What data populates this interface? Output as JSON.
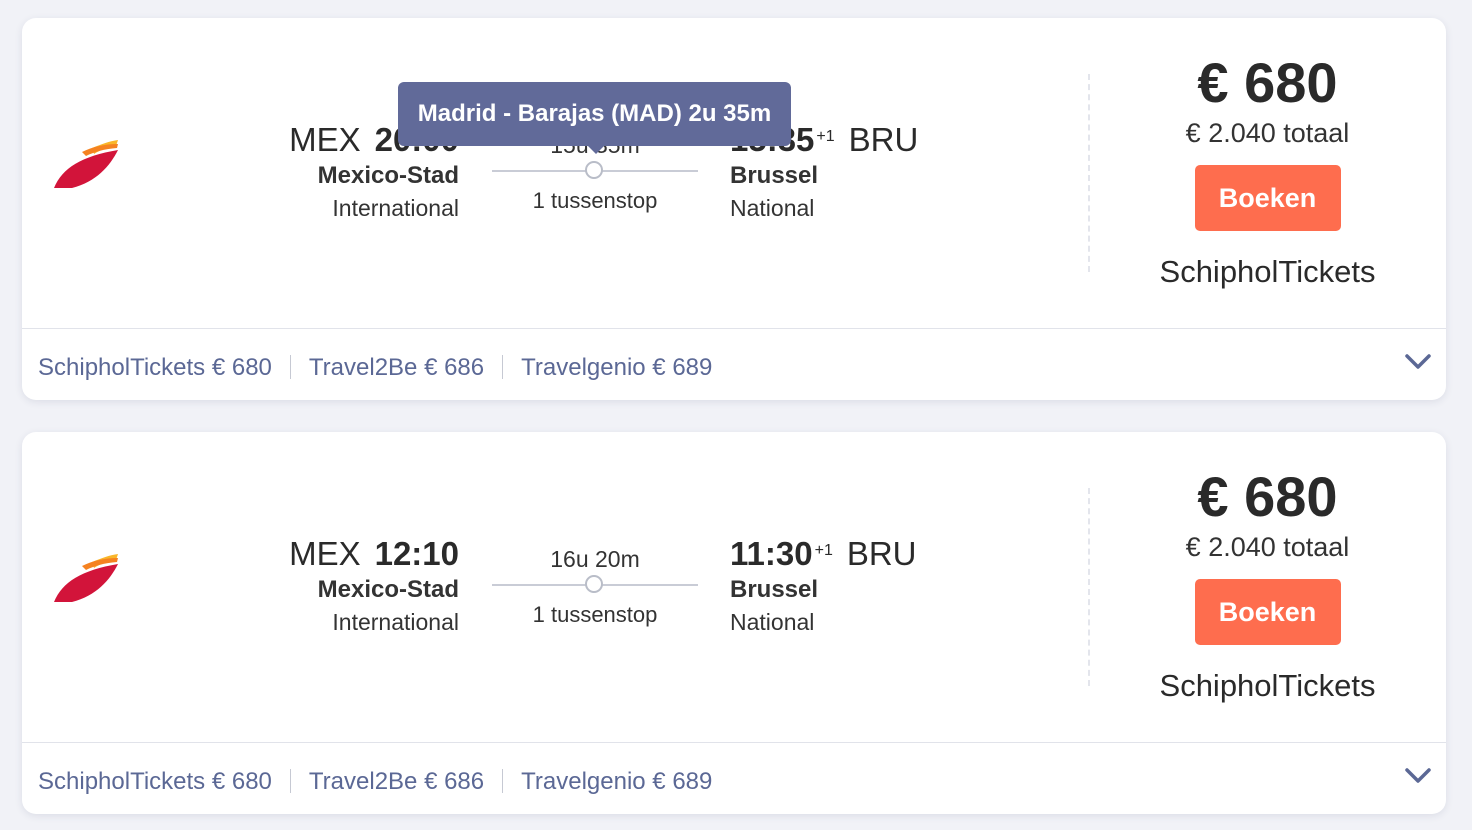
{
  "tooltip": {
    "text": "Madrid - Barajas (MAD) 2u 35m"
  },
  "flights": [
    {
      "departure": {
        "code": "MEX",
        "time": "20:00",
        "city": "Mexico-Stad",
        "airport": "International"
      },
      "arrival": {
        "code": "BRU",
        "time": "15:35",
        "day_offset": "+1",
        "city": "Brussel",
        "airport": "National"
      },
      "duration": "15u 35m",
      "stops": "1 tussenstop",
      "price": "€ 680",
      "total": "€ 2.040 totaal",
      "book_label": "Boeken",
      "seller": "SchipholTickets",
      "providers": [
        {
          "label": "SchipholTickets € 680"
        },
        {
          "label": "Travel2Be € 686"
        },
        {
          "label": "Travelgenio € 689"
        }
      ]
    },
    {
      "departure": {
        "code": "MEX",
        "time": "12:10",
        "city": "Mexico-Stad",
        "airport": "International"
      },
      "arrival": {
        "code": "BRU",
        "time": "11:30",
        "day_offset": "+1",
        "city": "Brussel",
        "airport": "National"
      },
      "duration": "16u 20m",
      "stops": "1 tussenstop",
      "price": "€ 680",
      "total": "€ 2.040 totaal",
      "book_label": "Boeken",
      "seller": "SchipholTickets",
      "providers": [
        {
          "label": "SchipholTickets € 680"
        },
        {
          "label": "Travel2Be € 686"
        },
        {
          "label": "Travelgenio € 689"
        }
      ]
    }
  ],
  "colors": {
    "accent_button": "#fe6d4e",
    "tooltip_bg": "#616a99",
    "provider_link": "#5b6895",
    "airline_logo_red": "#d2143a",
    "airline_logo_yellow": "#f9b629"
  },
  "icons": {
    "airline_logo": "iberia-logo",
    "expand": "chevron-down-icon",
    "stop_marker": "stop-dot-icon"
  }
}
